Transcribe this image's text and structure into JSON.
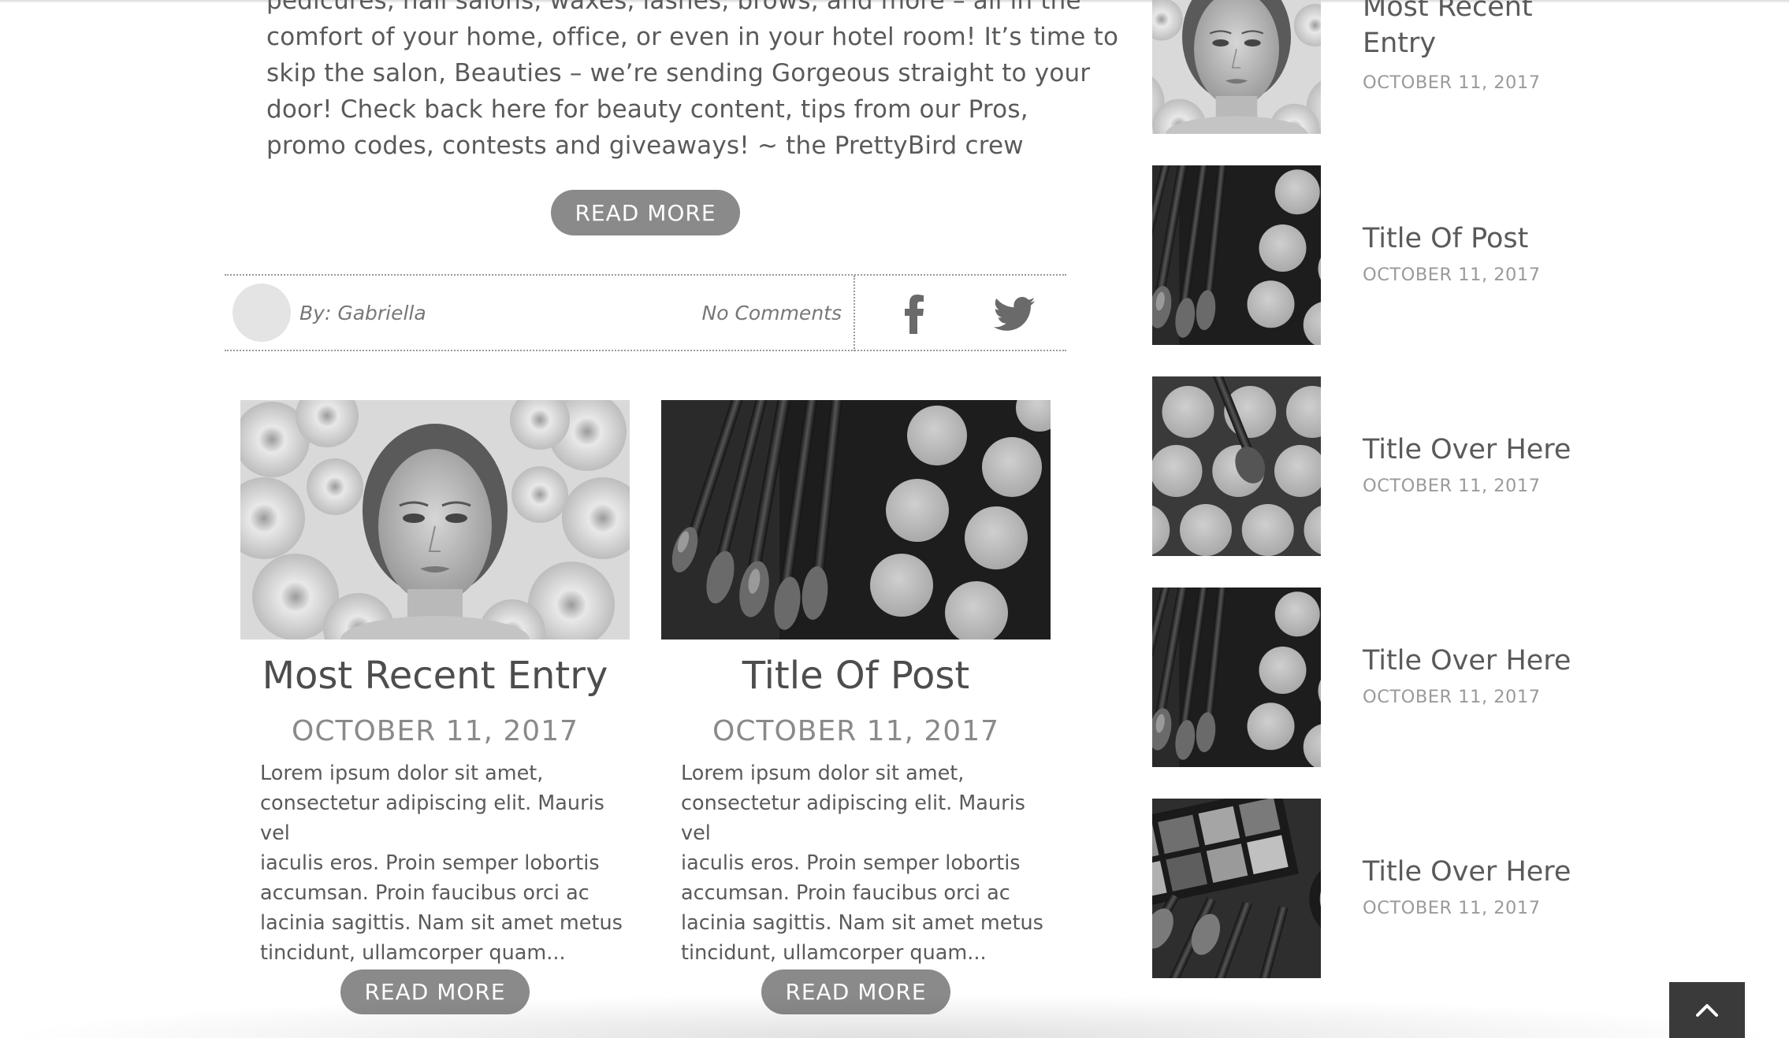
{
  "intro": {
    "line_0": "pedicures, nail salons, waxes, lashes, brows, and more – all in the",
    "line_1": "comfort of your home, office, or even in your hotel room!   It’s time to",
    "line_2": "skip the salon, Beauties – we’re sending Gorgeous straight to your",
    "line_3": "door!   Check back here for beauty content, tips from our Pros,",
    "line_4": "promo codes, contests and giveaways! ~ the PrettyBird crew",
    "read_more": "READ MORE"
  },
  "meta": {
    "byline": "By: Gabriella",
    "comments": "No Comments"
  },
  "cards": [
    {
      "title": "Most Recent Entry",
      "date": "OCTOBER 11, 2017",
      "excerpt": [
        "Lorem ipsum dolor sit amet,",
        "consectetur adipiscing elit. Mauris vel",
        "iaculis eros. Proin semper lobortis",
        "accumsan. Proin faucibus orci ac",
        "lacinia sagittis. Nam sit amet metus",
        "tincidunt, ullamcorper quam..."
      ],
      "read_more": "READ MORE"
    },
    {
      "title": "Title Of Post",
      "date": "OCTOBER 11, 2017",
      "excerpt": [
        "Lorem ipsum dolor sit amet,",
        "consectetur adipiscing elit. Mauris vel",
        "iaculis eros. Proin semper lobortis",
        "accumsan. Proin faucibus orci ac",
        "lacinia sagittis. Nam sit amet metus",
        "tincidunt, ullamcorper quam..."
      ],
      "read_more": "READ MORE"
    }
  ],
  "sidebar": [
    {
      "title_l1": "Most Recent",
      "title_l2": "Entry",
      "date": "OCTOBER 11, 2017"
    },
    {
      "title_l1": "Title Of Post",
      "date": "OCTOBER 11, 2017"
    },
    {
      "title_l1": "Title Over Here",
      "date": "OCTOBER 11, 2017"
    },
    {
      "title_l1": "Title Over Here",
      "date": "OCTOBER 11, 2017"
    },
    {
      "title_l1": "Title Over Here",
      "date": "OCTOBER 11, 2017"
    }
  ],
  "icons": {
    "facebook": "facebook-icon",
    "twitter": "twitter-icon",
    "back_to_top": "chevron-up-icon"
  },
  "colors": {
    "button": "#8a8a8a",
    "back_to_top": "#3a3a3a"
  }
}
